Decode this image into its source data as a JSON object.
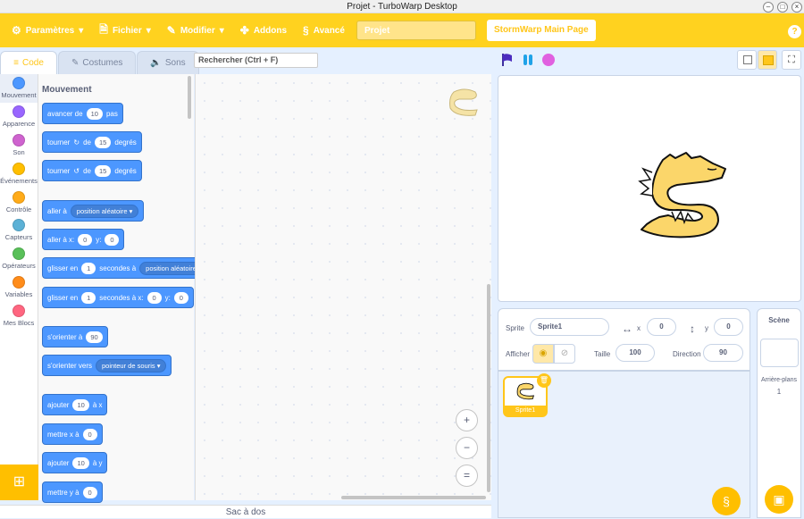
{
  "window": {
    "title": "Projet - TurboWarp Desktop"
  },
  "menu": {
    "settings": "Paramètres",
    "file": "Fichier",
    "edit": "Modifier",
    "addons": "Addons",
    "advanced": "Avancé",
    "project_title": "Projet",
    "main_page": "StormWarp Main Page",
    "help": "?"
  },
  "tabs": {
    "code": "Code",
    "costumes": "Costumes",
    "sounds": "Sons"
  },
  "search": {
    "placeholder": "Rechercher (Ctrl + F)"
  },
  "categories": [
    {
      "label": "Mouvement",
      "color": "#4c97ff"
    },
    {
      "label": "Apparence",
      "color": "#9966ff"
    },
    {
      "label": "Son",
      "color": "#cf63cf"
    },
    {
      "label": "Événements",
      "color": "#ffbf00"
    },
    {
      "label": "Contrôle",
      "color": "#ffab19"
    },
    {
      "label": "Capteurs",
      "color": "#5cb1d6"
    },
    {
      "label": "Opérateurs",
      "color": "#59c059"
    },
    {
      "label": "Variables",
      "color": "#ff8c1a"
    },
    {
      "label": "Mes Blocs",
      "color": "#ff6680"
    }
  ],
  "palette": {
    "section": "Mouvement",
    "move": {
      "a": "avancer de",
      "v": "10",
      "b": "pas"
    },
    "turn_right": {
      "a": "tourner",
      "b": "de",
      "v": "15",
      "c": "degrés"
    },
    "turn_left": {
      "a": "tourner",
      "b": "de",
      "v": "15",
      "c": "degrés"
    },
    "goto": {
      "a": "aller à",
      "dd": "position aléatoire"
    },
    "goto_xy": {
      "a": "aller à x:",
      "x": "0",
      "b": "y:",
      "y": "0"
    },
    "glide": {
      "a": "glisser en",
      "v": "1",
      "b": "secondes à",
      "dd": "position aléatoire"
    },
    "glide_xy": {
      "a": "glisser en",
      "v": "1",
      "b": "secondes à x:",
      "x": "0",
      "c": "y:",
      "y": "0"
    },
    "point_dir": {
      "a": "s'orienter à",
      "v": "90"
    },
    "point_towards": {
      "a": "s'orienter vers",
      "dd": "pointeur de souris"
    },
    "change_x": {
      "a": "ajouter",
      "v": "10",
      "b": "à x"
    },
    "set_x": {
      "a": "mettre x à",
      "v": "0"
    },
    "change_y": {
      "a": "ajouter",
      "v": "10",
      "b": "à y"
    },
    "set_y": {
      "a": "mettre y à",
      "v": "0"
    }
  },
  "zoom": {
    "in": "+",
    "out": "−",
    "reset": "="
  },
  "backpack": "Sac à dos",
  "sprite_info": {
    "sprite_label": "Sprite",
    "sprite_name": "Sprite1",
    "x_label": "x",
    "x": "0",
    "y_label": "y",
    "y": "0",
    "show_label": "Afficher",
    "size_label": "Taille",
    "size": "100",
    "direction_label": "Direction",
    "direction": "90"
  },
  "sprites": [
    {
      "name": "Sprite1"
    }
  ],
  "stage_panel": {
    "title": "Scène",
    "backdrops_label": "Arrière-plans",
    "backdrops_count": "1"
  }
}
